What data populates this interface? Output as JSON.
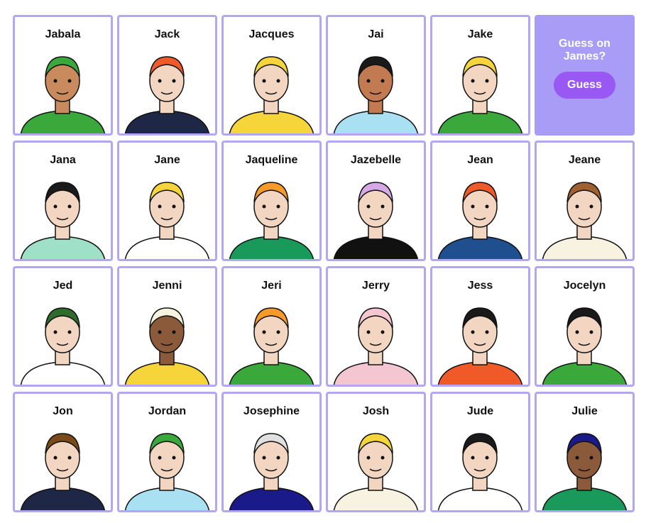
{
  "guess": {
    "prompt": "Guess on James?",
    "button_label": "Guess"
  },
  "characters": [
    {
      "name": "Jabala",
      "skin": "#c98b5e",
      "hair": "#3aa83a",
      "shirt": "#3aa83a",
      "icon": "hijab-sunglasses-avatar"
    },
    {
      "name": "Jack",
      "skin": "#f3d6c2",
      "hair": "#f05a28",
      "shirt": "#1f2747",
      "icon": "pirate-avatar"
    },
    {
      "name": "Jacques",
      "skin": "#f3d6c2",
      "hair": "#f6d53b",
      "shirt": "#f6d53b",
      "icon": "fisherman-avatar"
    },
    {
      "name": "Jai",
      "skin": "#c27a50",
      "hair": "#1a1a1a",
      "shirt": "#a9e0f2",
      "icon": "jai-avatar"
    },
    {
      "name": "Jake",
      "skin": "#f3d6c2",
      "hair": "#f6d53b",
      "shirt": "#3aa83a",
      "icon": "jake-avatar"
    },
    {
      "name": "Jana",
      "skin": "#f3d6c2",
      "hair": "#1a1a1a",
      "shirt": "#9fe0c8",
      "icon": "jana-avatar"
    },
    {
      "name": "Jane",
      "skin": "#f3d6c2",
      "hair": "#f6d53b",
      "shirt": "#ffffff",
      "icon": "jane-avatar"
    },
    {
      "name": "Jaqueline",
      "skin": "#f3d6c2",
      "hair": "#f79a2a",
      "shirt": "#1a9a5a",
      "icon": "jaqueline-avatar"
    },
    {
      "name": "Jazebelle",
      "skin": "#f3d6c2",
      "hair": "#d7a8e6",
      "shirt": "#111111",
      "icon": "jazebelle-avatar"
    },
    {
      "name": "Jean",
      "skin": "#f3d6c2",
      "hair": "#f05a28",
      "shirt": "#1f4f8f",
      "icon": "jean-avatar"
    },
    {
      "name": "Jeane",
      "skin": "#f3d6c2",
      "hair": "#a06030",
      "shirt": "#f7f3e0",
      "icon": "jeane-avatar"
    },
    {
      "name": "Jed",
      "skin": "#f3d6c2",
      "hair": "#2f6b2a",
      "shirt": "#ffffff",
      "icon": "jed-avatar"
    },
    {
      "name": "Jenni",
      "skin": "#8a5a3a",
      "hair": "#f7f3e0",
      "shirt": "#f6d53b",
      "icon": "jenni-avatar"
    },
    {
      "name": "Jeri",
      "skin": "#f3d6c2",
      "hair": "#f79a2a",
      "shirt": "#3aa83a",
      "icon": "jeri-avatar"
    },
    {
      "name": "Jerry",
      "skin": "#f3d6c2",
      "hair": "#f4c6d2",
      "shirt": "#f4c6d2",
      "icon": "jerry-avatar"
    },
    {
      "name": "Jess",
      "skin": "#f3d6c2",
      "hair": "#1a1a1a",
      "shirt": "#f05a28",
      "icon": "jess-avatar"
    },
    {
      "name": "Jocelyn",
      "skin": "#f3d6c2",
      "hair": "#1a1a1a",
      "shirt": "#3aa83a",
      "icon": "jocelyn-avatar"
    },
    {
      "name": "Jon",
      "skin": "#f3d6c2",
      "hair": "#7a4a1a",
      "shirt": "#1f2747",
      "icon": "jon-avatar"
    },
    {
      "name": "Jordan",
      "skin": "#f3d6c2",
      "hair": "#3aa83a",
      "shirt": "#a9e0f2",
      "icon": "jordan-avatar"
    },
    {
      "name": "Josephine",
      "skin": "#f3d6c2",
      "hair": "#e0e0e0",
      "shirt": "#1a1a8a",
      "icon": "josephine-avatar"
    },
    {
      "name": "Josh",
      "skin": "#f3d6c2",
      "hair": "#f6d53b",
      "shirt": "#f7f3e0",
      "icon": "josh-avatar"
    },
    {
      "name": "Jude",
      "skin": "#f3d6c2",
      "hair": "#1a1a1a",
      "shirt": "#ffffff",
      "icon": "jude-avatar"
    },
    {
      "name": "Julie",
      "skin": "#8a5a3a",
      "hair": "#1a1a8a",
      "shirt": "#1a9a5a",
      "icon": "julie-avatar"
    }
  ]
}
